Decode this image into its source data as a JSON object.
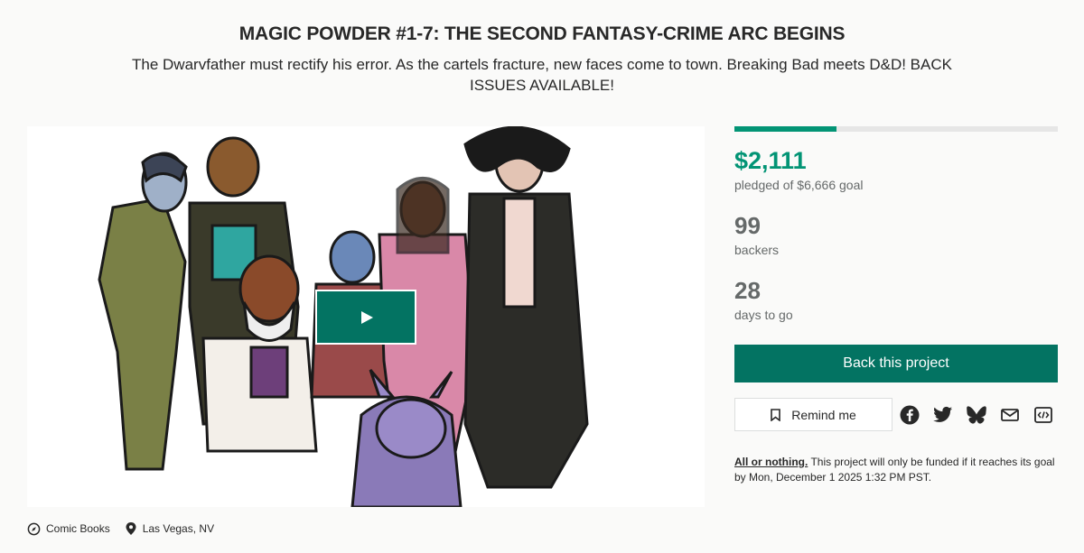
{
  "project": {
    "title": "MAGIC POWDER #1-7: THE SECOND FANTASY-CRIME ARC BEGINS",
    "subtitle": "The Dwarvfather must rectify his error. As the cartels fracture, new faces come to town. Breaking Bad meets D&D! BACK ISSUES AVAILABLE!",
    "category": "Comic Books",
    "location": "Las Vegas, NV"
  },
  "stats": {
    "progress_fraction": 0.317,
    "pledged": "$2,111",
    "pledged_label": "pledged of $6,666 goal",
    "backers": "99",
    "backers_label": "backers",
    "days": "28",
    "days_label": "days to go"
  },
  "actions": {
    "back_label": "Back this project",
    "remind_label": "Remind me"
  },
  "share_icons": [
    "facebook-icon",
    "twitter-icon",
    "bluesky-icon",
    "email-icon",
    "embed-icon"
  ],
  "funding_note": {
    "lead": "All or nothing.",
    "text": " This project will only be funded if it reaches its goal by Mon, December 1 2025 1:32 PM PST."
  },
  "colors": {
    "accent": "#037362",
    "pledged": "#029475",
    "muted": "#656969"
  }
}
